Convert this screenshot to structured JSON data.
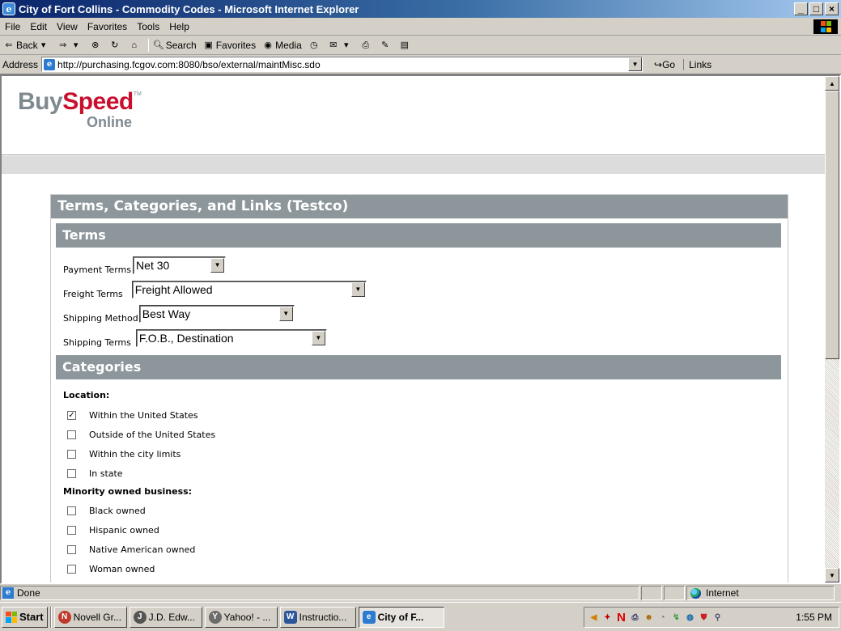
{
  "window": {
    "title": "City of Fort Collins - Commodity Codes - Microsoft Internet Explorer",
    "minimize": "_",
    "maximize": "□",
    "close": "×"
  },
  "menu": [
    "File",
    "Edit",
    "View",
    "Favorites",
    "Tools",
    "Help"
  ],
  "toolbar": {
    "back": "Back",
    "search": "Search",
    "favorites": "Favorites",
    "media": "Media"
  },
  "address": {
    "label": "Address",
    "url": "http://purchasing.fcgov.com:8080/bso/external/maintMisc.sdo",
    "go": "Go",
    "links": "Links"
  },
  "logo": {
    "buy": "Buy",
    "speed": "Speed",
    "tm": "TM",
    "online": "Online"
  },
  "page": {
    "title": "Terms, Categories, and Links (Testco)",
    "terms_header": "Terms",
    "categories_header": "Categories"
  },
  "terms": {
    "payment": {
      "label": "Payment Terms",
      "value": "Net 30"
    },
    "freight": {
      "label": "Freight Terms",
      "value": "Freight Allowed"
    },
    "shipping_method": {
      "label": "Shipping Method",
      "value": "Best Way"
    },
    "shipping_terms": {
      "label": "Shipping Terms",
      "value": "F.O.B., Destination"
    }
  },
  "categories": {
    "location": {
      "heading": "Location:",
      "items": [
        {
          "label": "Within the United States",
          "checked": true
        },
        {
          "label": "Outside of the United States",
          "checked": false
        },
        {
          "label": "Within the city limits",
          "checked": false
        },
        {
          "label": "In state",
          "checked": false
        }
      ]
    },
    "minority": {
      "heading": "Minority owned business:",
      "items": [
        {
          "label": "Black owned",
          "checked": false
        },
        {
          "label": "Hispanic owned",
          "checked": false
        },
        {
          "label": "Native American owned",
          "checked": false
        },
        {
          "label": "Woman owned",
          "checked": false
        }
      ]
    }
  },
  "status": {
    "text": "Done",
    "zone": "Internet"
  },
  "taskbar": {
    "start": "Start",
    "tasks": [
      {
        "label": "Novell Gr...",
        "icon": "novell-groupwise-icon"
      },
      {
        "label": "J.D. Edw...",
        "icon": "jd-edwards-icon"
      },
      {
        "label": "Yahoo! - ...",
        "icon": "yahoo-icon"
      },
      {
        "label": "Instructio...",
        "icon": "word-document-icon"
      },
      {
        "label": "City of F...",
        "icon": "internet-explorer-icon"
      }
    ],
    "clock": "1:55 PM"
  },
  "colors": {
    "section_header": "#8c969b",
    "logo_grey": "#7f8a90",
    "logo_red": "#c8102e",
    "titlebar_start": "#0a246a"
  }
}
